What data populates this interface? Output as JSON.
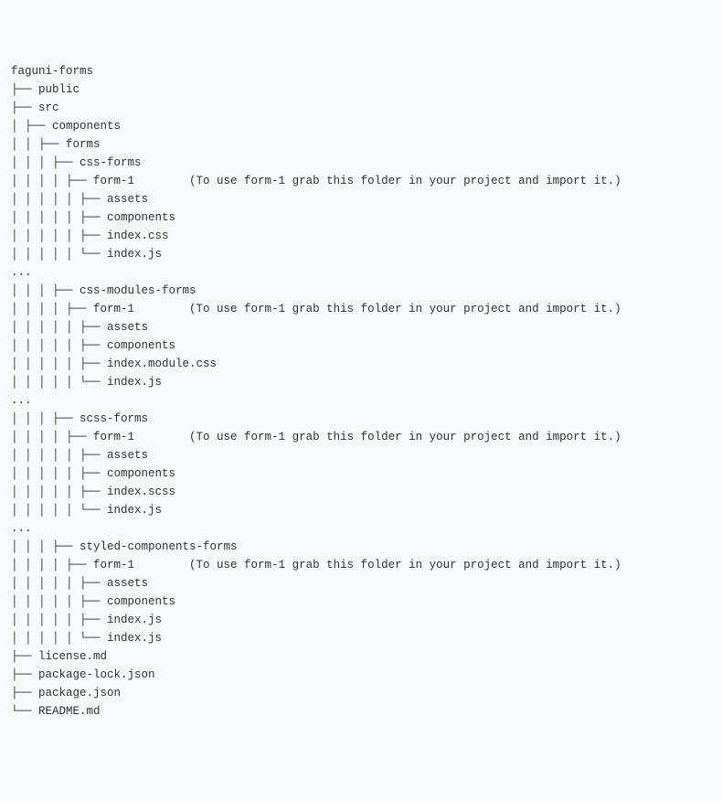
{
  "lines": [
    {
      "prefix": "",
      "name": "faguni-forms",
      "note": ""
    },
    {
      "prefix": "├── ",
      "name": "public",
      "note": ""
    },
    {
      "prefix": "├── ",
      "name": "src",
      "note": ""
    },
    {
      "prefix": "│ ├── ",
      "name": "components",
      "note": ""
    },
    {
      "prefix": "│ │ ├── ",
      "name": "forms",
      "note": ""
    },
    {
      "prefix": "│ │ │ ├── ",
      "name": "css-forms",
      "note": ""
    },
    {
      "prefix": "│ │ │ │ ├── ",
      "name": "form-1        ",
      "note": "(To use form-1 grab this folder in your project and import it.)"
    },
    {
      "prefix": "│ │ │ │ │ ├── ",
      "name": "assets",
      "note": ""
    },
    {
      "prefix": "│ │ │ │ │ ├── ",
      "name": "components",
      "note": ""
    },
    {
      "prefix": "│ │ │ │ │ ├── ",
      "name": "index.css",
      "note": ""
    },
    {
      "prefix": "│ │ │ │ │ └── ",
      "name": "index.js",
      "note": ""
    },
    {
      "prefix": "...",
      "name": "",
      "note": ""
    },
    {
      "prefix": "│ │ │ ├── ",
      "name": "css-modules-forms",
      "note": ""
    },
    {
      "prefix": "│ │ │ │ ├── ",
      "name": "form-1        ",
      "note": "(To use form-1 grab this folder in your project and import it.)"
    },
    {
      "prefix": "│ │ │ │ │ ├── ",
      "name": "assets",
      "note": ""
    },
    {
      "prefix": "│ │ │ │ │ ├── ",
      "name": "components",
      "note": ""
    },
    {
      "prefix": "│ │ │ │ │ ├── ",
      "name": "index.module.css",
      "note": ""
    },
    {
      "prefix": "│ │ │ │ │ └── ",
      "name": "index.js",
      "note": ""
    },
    {
      "prefix": "...",
      "name": "",
      "note": ""
    },
    {
      "prefix": "│ │ │ ├── ",
      "name": "scss-forms",
      "note": ""
    },
    {
      "prefix": "│ │ │ │ ├── ",
      "name": "form-1        ",
      "note": "(To use form-1 grab this folder in your project and import it.)"
    },
    {
      "prefix": "│ │ │ │ │ ├── ",
      "name": "assets",
      "note": ""
    },
    {
      "prefix": "│ │ │ │ │ ├── ",
      "name": "components",
      "note": ""
    },
    {
      "prefix": "│ │ │ │ │ ├── ",
      "name": "index.scss",
      "note": ""
    },
    {
      "prefix": "│ │ │ │ │ └── ",
      "name": "index.js",
      "note": ""
    },
    {
      "prefix": "...",
      "name": "",
      "note": ""
    },
    {
      "prefix": "│ │ │ ├── ",
      "name": "styled-components-forms",
      "note": ""
    },
    {
      "prefix": "│ │ │ │ ├── ",
      "name": "form-1        ",
      "note": "(To use form-1 grab this folder in your project and import it.)"
    },
    {
      "prefix": "│ │ │ │ │ ├── ",
      "name": "assets",
      "note": ""
    },
    {
      "prefix": "│ │ │ │ │ ├── ",
      "name": "components",
      "note": ""
    },
    {
      "prefix": "│ │ │ │ │ ├── ",
      "name": "index.js",
      "note": ""
    },
    {
      "prefix": "│ │ │ │ │ └── ",
      "name": "index.js",
      "note": ""
    },
    {
      "prefix": "├── ",
      "name": "license.md",
      "note": ""
    },
    {
      "prefix": "├── ",
      "name": "package-lock.json",
      "note": ""
    },
    {
      "prefix": "├── ",
      "name": "package.json",
      "note": ""
    },
    {
      "prefix": "└── ",
      "name": "README.md",
      "note": ""
    }
  ]
}
